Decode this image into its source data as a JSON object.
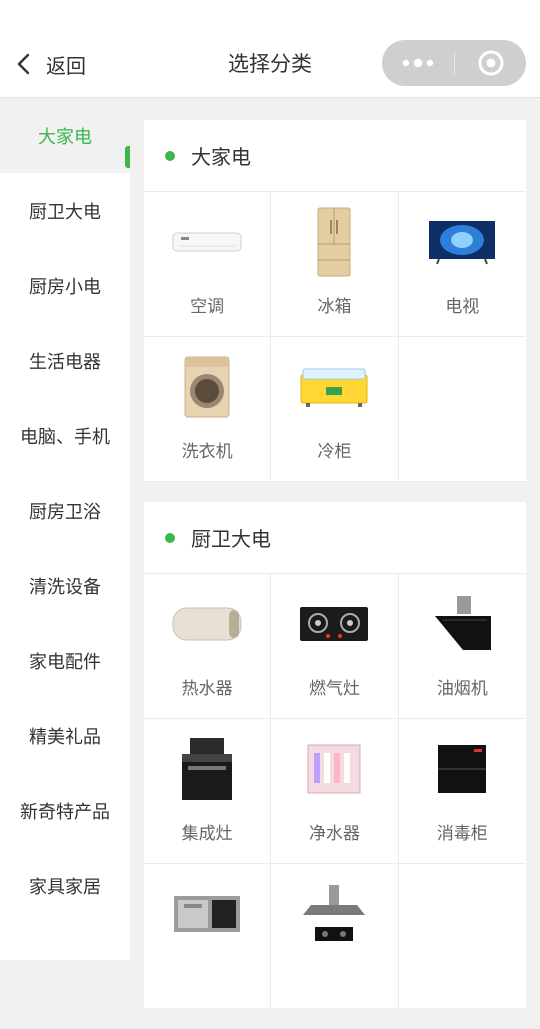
{
  "header": {
    "back_label": "返回",
    "title": "选择分类"
  },
  "sidebar": {
    "items": [
      {
        "label": "大家电",
        "active": true
      },
      {
        "label": "厨卫大电"
      },
      {
        "label": "厨房小电"
      },
      {
        "label": "生活电器"
      },
      {
        "label": "电脑、手机"
      },
      {
        "label": "厨房卫浴"
      },
      {
        "label": "清洗设备"
      },
      {
        "label": "家电配件"
      },
      {
        "label": "精美礼品"
      },
      {
        "label": "新奇特产品"
      },
      {
        "label": "家具家居"
      }
    ]
  },
  "sections": [
    {
      "title": "大家电",
      "items": [
        {
          "label": "空调",
          "icon": "air-conditioner-icon"
        },
        {
          "label": "冰箱",
          "icon": "refrigerator-icon"
        },
        {
          "label": "电视",
          "icon": "television-icon"
        },
        {
          "label": "洗衣机",
          "icon": "washing-machine-icon"
        },
        {
          "label": "冷柜",
          "icon": "chest-freezer-icon"
        }
      ]
    },
    {
      "title": "厨卫大电",
      "items": [
        {
          "label": "热水器",
          "icon": "water-heater-icon"
        },
        {
          "label": "燃气灶",
          "icon": "gas-stove-icon"
        },
        {
          "label": "油烟机",
          "icon": "range-hood-icon"
        },
        {
          "label": "集成灶",
          "icon": "integrated-stove-icon"
        },
        {
          "label": "净水器",
          "icon": "water-purifier-icon"
        },
        {
          "label": "消毒柜",
          "icon": "disinfection-cabinet-icon"
        },
        {
          "label": "",
          "icon": "sink-icon"
        },
        {
          "label": "",
          "icon": "chimney-hood-icon"
        }
      ]
    }
  ],
  "colors": {
    "accent": "#3cb74a",
    "background": "#f1f1f1"
  }
}
